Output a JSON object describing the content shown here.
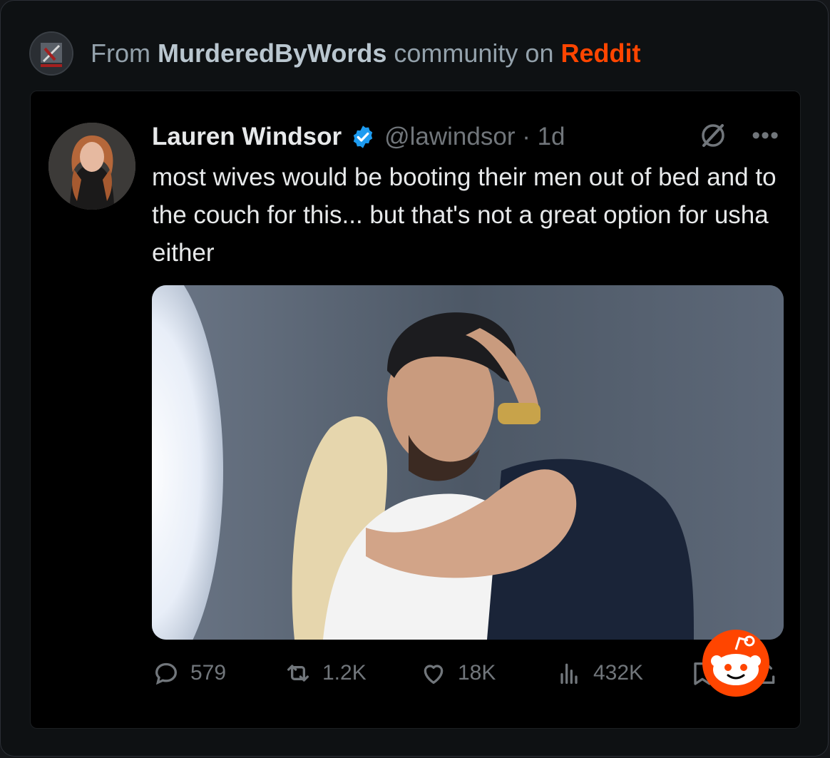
{
  "header": {
    "prefix": "From ",
    "community": "MurderedByWords",
    "middle": " community on ",
    "platform": "Reddit",
    "subreddit_icon": "murderedbywords-community-icon",
    "platform_color": "#ff4500"
  },
  "tweet": {
    "author_name": "Lauren Windsor",
    "handle": "@lawindsor",
    "time": " · 1d",
    "verified_icon": "verified-badge-icon",
    "text": "most wives would be booting their men out of bed and to the couch for this... but that's not a great option for usha either",
    "media_icon": "embrace-photo",
    "actions": {
      "replies": "579",
      "reposts": "1.2K",
      "likes": "18K",
      "views": "432K"
    }
  },
  "overlay": {
    "icon": "reddit-snoo-icon",
    "color": "#ff4500"
  }
}
